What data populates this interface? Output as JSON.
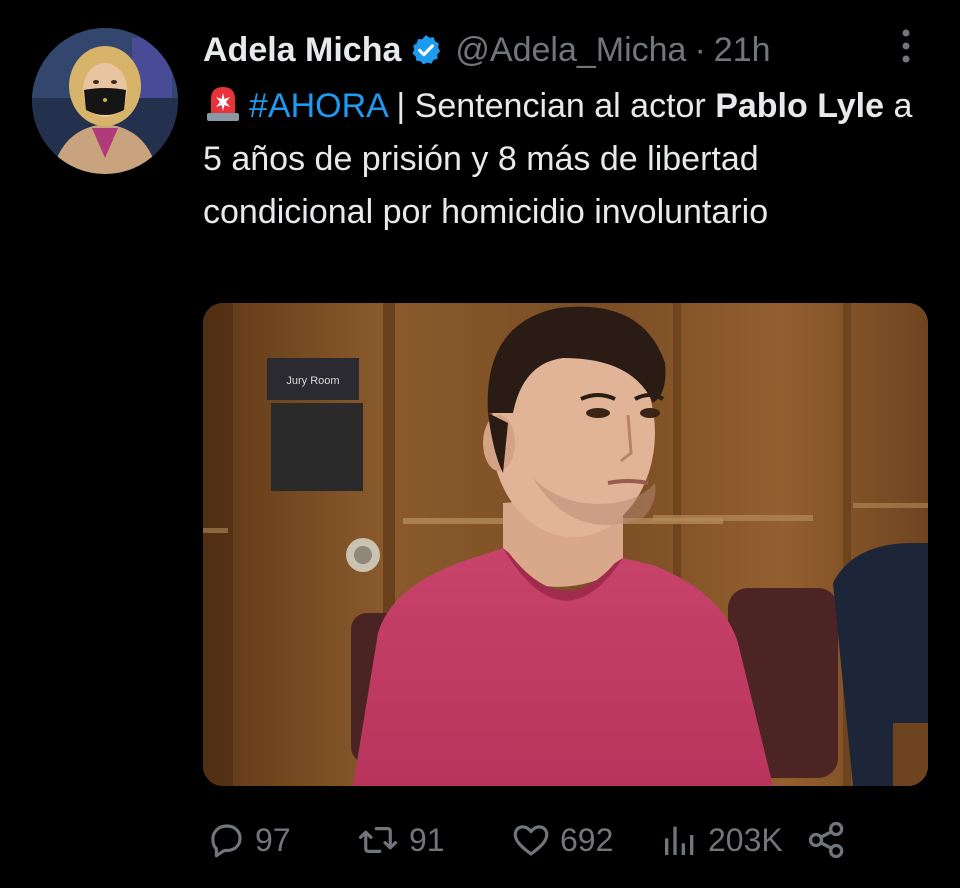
{
  "tweet": {
    "author": {
      "display_name": "Adela Micha",
      "handle": "@Adela_Micha",
      "verified": true
    },
    "separator": "·",
    "time": "21h",
    "text": {
      "hashtag": "#AHORA",
      "part1": " | Sentencian al actor ",
      "bold1": "Pablo Lyle",
      "part2": " a 5 años de prisión y 8 más de libertad condicional por homicidio involuntario"
    },
    "media": {
      "sign_text": "Jury Room"
    },
    "metrics": {
      "replies": "97",
      "retweets": "91",
      "likes": "692",
      "views": "203K"
    },
    "icons": {
      "verified": "verified-badge-icon",
      "siren": "rotating-light-emoji",
      "more": "more-options-icon",
      "reply": "reply-icon",
      "retweet": "retweet-icon",
      "like": "heart-icon",
      "views": "views-bar-chart-icon",
      "share": "share-icon"
    },
    "colors": {
      "background": "#000000",
      "text": "#e7e9ea",
      "secondary": "#71767b",
      "accent": "#1d9bf0"
    }
  }
}
